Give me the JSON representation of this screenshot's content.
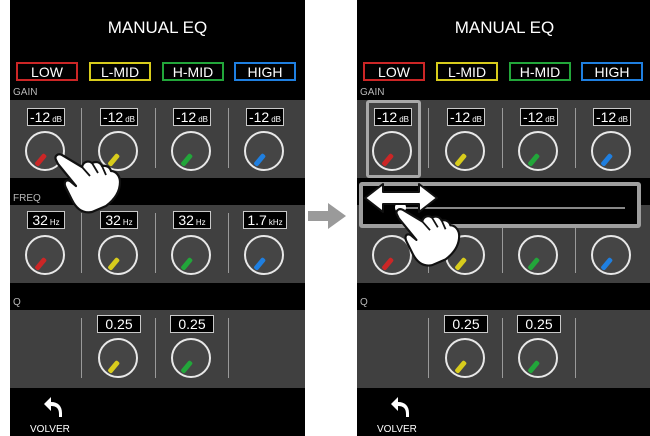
{
  "panels": [
    {
      "title": "MANUAL EQ",
      "bands": [
        {
          "label": "LOW",
          "color": "#cc2626"
        },
        {
          "label": "L-MID",
          "color": "#d8cc1c"
        },
        {
          "label": "H-MID",
          "color": "#22a63a"
        },
        {
          "label": "HIGH",
          "color": "#1f7fe0"
        }
      ],
      "gain": {
        "label": "GAIN",
        "values": [
          {
            "num": "-12",
            "unit": "dB"
          },
          {
            "num": "-12",
            "unit": "dB"
          },
          {
            "num": "-12",
            "unit": "dB"
          },
          {
            "num": "-12",
            "unit": "dB"
          }
        ]
      },
      "freq": {
        "label": "FREQ",
        "values": [
          {
            "num": "32",
            "unit": "Hz"
          },
          {
            "num": "32",
            "unit": "Hz"
          },
          {
            "num": "32",
            "unit": "Hz"
          },
          {
            "num": "1.7",
            "unit": "kHz"
          }
        ]
      },
      "q": {
        "label": "Q",
        "values": [
          {
            "num": "0.25"
          },
          {
            "num": "0.25"
          }
        ]
      },
      "back_label": "VOLVER"
    },
    {
      "title": "MANUAL EQ",
      "bands": [
        {
          "label": "LOW",
          "color": "#cc2626"
        },
        {
          "label": "L-MID",
          "color": "#d8cc1c"
        },
        {
          "label": "H-MID",
          "color": "#22a63a"
        },
        {
          "label": "HIGH",
          "color": "#1f7fe0"
        }
      ],
      "gain": {
        "label": "GAIN",
        "values": [
          {
            "num": "-12",
            "unit": "dB"
          },
          {
            "num": "-12",
            "unit": "dB"
          },
          {
            "num": "-12",
            "unit": "dB"
          },
          {
            "num": "-12",
            "unit": "dB"
          }
        ]
      },
      "q": {
        "label": "Q",
        "values": [
          {
            "num": "0.25"
          },
          {
            "num": "0.25"
          }
        ]
      },
      "back_label": "VOLVER",
      "slider": {
        "level": 0.0
      }
    }
  ],
  "colors": {
    "knob_ring": "#e8e8e8",
    "section_bg": "#404040",
    "highlight": "#a8a8a8"
  },
  "icons": {
    "back": "back-curved-arrow-icon",
    "gesture": "pointing-hand-icon",
    "swipe": "double-arrow-icon",
    "step": "right-arrow-icon"
  }
}
